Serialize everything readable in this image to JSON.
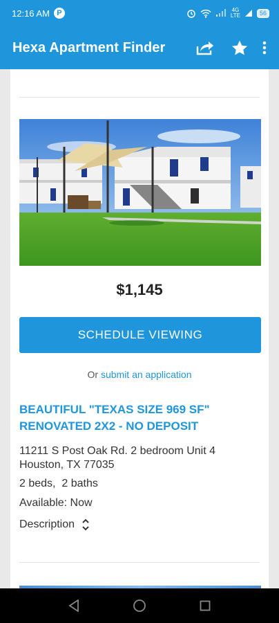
{
  "status_bar": {
    "time": "12:16 AM",
    "app_badge": "P",
    "network_top": "4G",
    "network_bottom": "LTE",
    "battery": "56"
  },
  "app_bar": {
    "title": "Hexa Apartment Finder",
    "icons": [
      "share-icon",
      "star-icon",
      "more-vert-icon"
    ]
  },
  "listing": {
    "price": "$1,145",
    "schedule_label": "SCHEDULE VIEWING",
    "apply_prefix": "Or ",
    "apply_link": "submit an application",
    "title": "BEAUTIFUL \"TEXAS SIZE 969 SF\" RENOVATED 2X2 - NO DEPOSIT",
    "address": "11211 S Post Oak Rd. 2 bedroom Unit 4 Houston, TX 77035",
    "beds_baths": "2 beds,  2 baths",
    "available": "Available: Now",
    "description_label": "Description"
  },
  "colors": {
    "primary": "#1f95db",
    "text": "#333333"
  }
}
